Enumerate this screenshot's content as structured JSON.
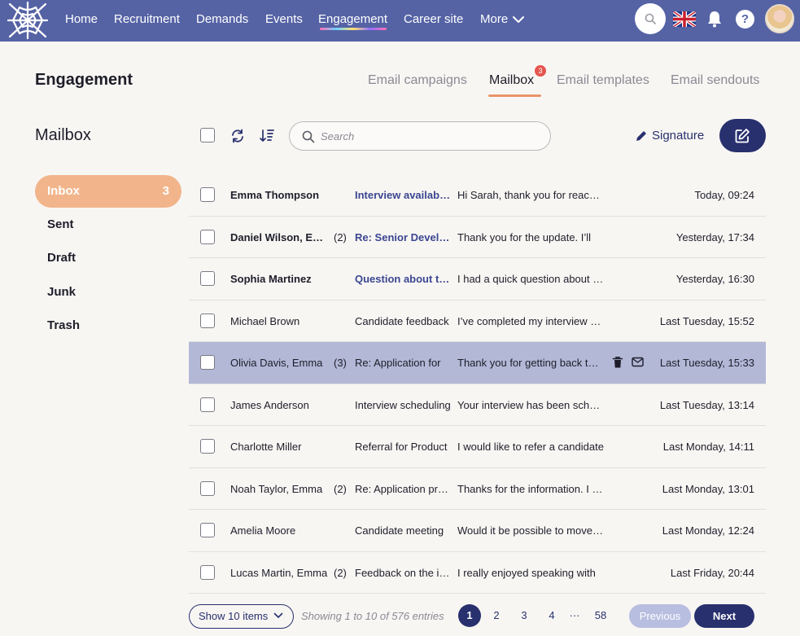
{
  "nav": {
    "items": [
      {
        "label": "Home"
      },
      {
        "label": "Recruitment"
      },
      {
        "label": "Demands"
      },
      {
        "label": "Events"
      },
      {
        "label": "Engagement"
      },
      {
        "label": "Career site"
      },
      {
        "label": "More"
      }
    ],
    "active": "Engagement",
    "language_flag": "uk-flag-icon",
    "help_label": "?"
  },
  "page": {
    "title": "Engagement"
  },
  "tabs": [
    {
      "label": "Email campaigns"
    },
    {
      "label": "Mailbox",
      "badge": "3"
    },
    {
      "label": "Email templates"
    },
    {
      "label": "Email sendouts"
    }
  ],
  "mailbox": {
    "title": "Mailbox",
    "folders": [
      {
        "label": "Inbox",
        "count": "3"
      },
      {
        "label": "Sent"
      },
      {
        "label": "Draft"
      },
      {
        "label": "Junk"
      },
      {
        "label": "Trash"
      }
    ]
  },
  "toolbar": {
    "search_placeholder": "Search",
    "signature_label": "Signature"
  },
  "emails": [
    {
      "from": "Emma Thompson",
      "count": "",
      "subject": "Interview availability",
      "preview": "Hi Sarah, thank you for reaching out",
      "date": "Today, 09:24",
      "unread": true
    },
    {
      "from": "Daniel Wilson, Emma",
      "count": "(2)",
      "subject": "Re: Senior Developer",
      "preview": "Thank you for the update. I’ll",
      "date": "Yesterday, 17:34",
      "unread": true
    },
    {
      "from": "Sophia Martinez",
      "count": "",
      "subject": "Question about the role",
      "preview": "I had a quick question about the",
      "date": "Yesterday, 16:30",
      "unread": true
    },
    {
      "from": "Michael Brown",
      "count": "",
      "subject": "Candidate feedback",
      "preview": "I’ve completed my interview with",
      "date": "Last Tuesday, 15:52",
      "unread": false
    },
    {
      "from": "Olivia Davis, Emma",
      "count": "(3)",
      "subject": "Re: Application for",
      "preview": "Thank you for getting back to me",
      "date": "Last Tuesday, 15:33",
      "unread": false,
      "selected": true
    },
    {
      "from": "James Anderson",
      "count": "",
      "subject": "Interview scheduling",
      "preview": "Your interview has been scheduled",
      "date": "Last Tuesday, 13:14",
      "unread": false
    },
    {
      "from": "Charlotte Miller",
      "count": "",
      "subject": "Referral for Product",
      "preview": "I would like to refer a candidate",
      "date": "Last Monday, 14:11",
      "unread": false
    },
    {
      "from": "Noah Taylor, Emma",
      "count": "(2)",
      "subject": "Re: Application process",
      "preview": "Thanks for the information. I will",
      "date": "Last Monday, 13:01",
      "unread": false
    },
    {
      "from": "Amelia Moore",
      "count": "",
      "subject": "Candidate meeting",
      "preview": "Would it be possible to move the",
      "date": "Last Monday, 12:24",
      "unread": false
    },
    {
      "from": "Lucas Martin, Emma",
      "count": "(2)",
      "subject": "Feedback on the interview",
      "preview": "I really enjoyed speaking with",
      "date": "Last Friday, 20:44",
      "unread": false
    }
  ],
  "pagination": {
    "show_label": "Show 10 items",
    "showing_text": "Showing 1 to 10 of 576 entries",
    "pages": [
      "1",
      "2",
      "3",
      "4",
      "···",
      "58"
    ],
    "current": "1",
    "prev_label": "Previous",
    "next_label": "Next"
  },
  "colors": {
    "nav_bg": "#5563a5",
    "accent": "#28306e",
    "inbox_active": "#f2b58b",
    "tab_underline": "#e8946a",
    "badge": "#e5554f",
    "selected_row": "#b2b8d6"
  }
}
